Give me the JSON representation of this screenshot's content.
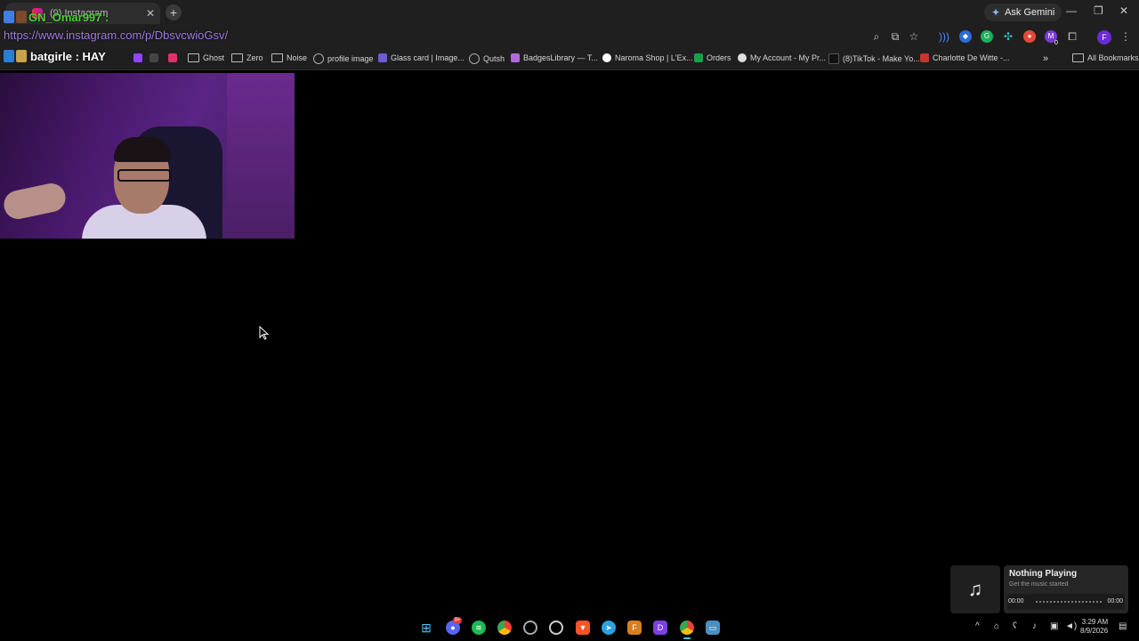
{
  "browser": {
    "tab_title": "(9) Instagram",
    "ask_gemini_label": "Ask Gemini",
    "profile_initial": "F",
    "extension_badge": "0",
    "bookmarks": [
      {
        "label": "Ghost",
        "icon": "folder-icon"
      },
      {
        "label": "Zero",
        "icon": "folder-icon"
      },
      {
        "label": "Noise",
        "icon": "folder-icon"
      },
      {
        "label": "profile image",
        "icon": "globe-icon"
      },
      {
        "label": "Glass card | Image...",
        "icon": "f-icon"
      },
      {
        "label": "Qutsh",
        "icon": "globe-icon"
      },
      {
        "label": "BadgesLibrary — T...",
        "icon": "badge-icon"
      },
      {
        "label": "Naroma Shop | L'Ex...",
        "icon": "naroma-icon"
      },
      {
        "label": "Orders",
        "icon": "sheets-icon"
      },
      {
        "label": "My Account - My Pr...",
        "icon": "hand-icon"
      },
      {
        "label": "(8)TikTok - Make Yo...",
        "icon": "tiktok-icon"
      },
      {
        "label": "Charlotte De Witte -...",
        "icon": "charlotte-icon"
      }
    ],
    "all_bookmarks_label": "All Bookmarks"
  },
  "overlay": {
    "chat_line1": "GN_Omar997 :",
    "chat_url": "https://www.instagram.com/p/DbsvcwioGsv/",
    "chat_line2": "batgirle : HAY"
  },
  "media": {
    "title": "Nothing Playing",
    "subtitle": "Get the music started",
    "time_start": "00:00",
    "time_end": "00:00",
    "icon": "music-note-icon"
  },
  "taskbar": {
    "discord_badge": "9+",
    "clock_time": "3:29 AM",
    "clock_date": "8/9/2026"
  },
  "colors": {
    "chrome_bg": "#1f1f1f",
    "chat_green": "#4cd137",
    "chat_purple": "#a07be0"
  }
}
